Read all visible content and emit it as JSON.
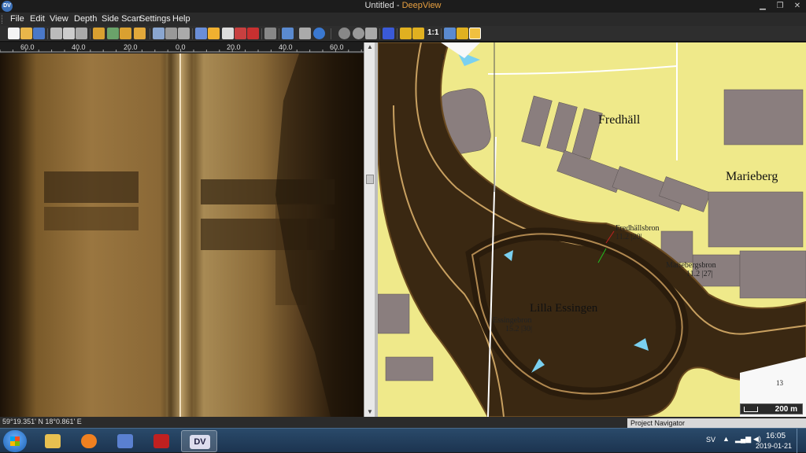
{
  "window": {
    "title_doc": "Untitled",
    "title_sep": " - ",
    "title_app": "DeepView",
    "app_icon": "DV",
    "controls": [
      "minimize-icon",
      "restore-icon",
      "close-icon"
    ]
  },
  "menu": {
    "items": [
      "File",
      "Edit",
      "View",
      "Depth",
      "Side Scan",
      "Settings",
      "Help"
    ]
  },
  "toolbar": {
    "zoom_ratio_label": "1:1",
    "icons": [
      "new-file-icon",
      "open-folder-icon",
      "save-icon",
      "cut-icon",
      "copy-icon",
      "paste-icon",
      "grid-icon",
      "layers-icon",
      "film-icon",
      "columns-icon",
      "zoom-in-icon",
      "pan-icon",
      "measure-icon",
      "select-icon",
      "draw-line-icon",
      "rectangle-icon",
      "undo-icon",
      "erase-icon",
      "target-icon",
      "ship-icon",
      "print-icon",
      "help-icon",
      "record-icon",
      "gps-icon",
      "marker-icon",
      "filter-icon",
      "ruler-icon",
      "range-icon",
      "pencil-icon",
      "search-zoom-icon"
    ]
  },
  "sonar": {
    "ruler_ticks": [
      "60.0",
      "40.0",
      "20.0",
      "0.0",
      "20.0",
      "40.0",
      "60.0"
    ]
  },
  "map": {
    "places": [
      "Fredhäll",
      "Marieberg",
      "Lilla Essingen"
    ],
    "bridges": [
      {
        "name": "Fredhällsbron",
        "values": "11.2 |20|"
      },
      {
        "name": "Mariebergsbron",
        "values": "11.2 |27|"
      },
      {
        "name": "Essingebron",
        "values": "15.2 |30|"
      }
    ],
    "small_labels": [
      "5",
      "13"
    ],
    "scale_label": "200 m"
  },
  "status": {
    "coordinates": "59°19.351' N  18°0.861' E",
    "project_navigator": "Project Navigator"
  },
  "taskbar": {
    "apps": [
      "windows-start-icon",
      "file-explorer-icon",
      "media-player-icon",
      "paint-icon",
      "mcafee-icon",
      "deepview-icon"
    ],
    "active_app_label": "DV",
    "language": "SV",
    "time": "16:05",
    "date": "2019-01-21"
  }
}
